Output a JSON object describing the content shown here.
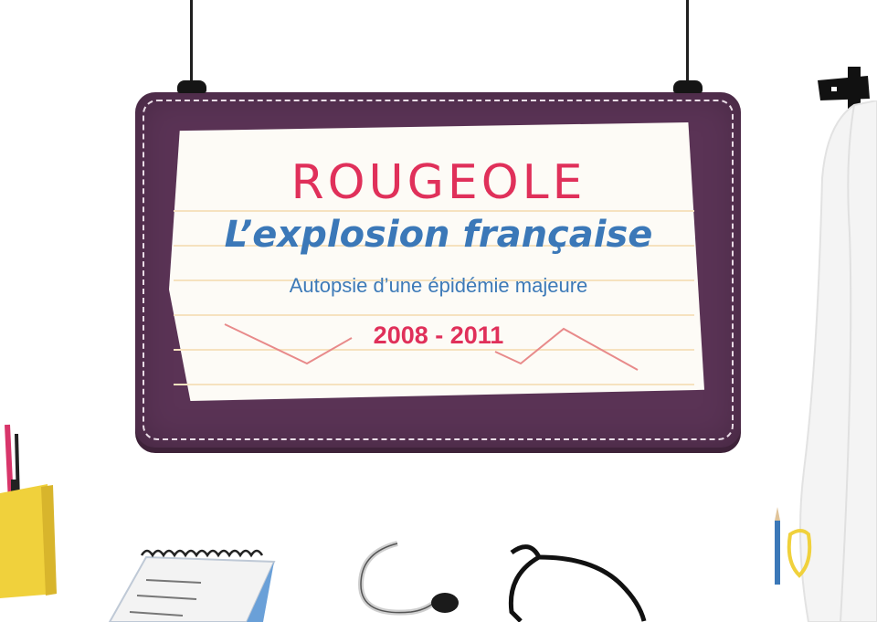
{
  "board": {
    "title": "ROUGEOLE",
    "headline": "L’explosion française",
    "subtitle": "Autopsie d’une épidémie majeure",
    "years": "2008 - 2011"
  },
  "colors": {
    "board": "#5a3355",
    "title": "#e0305a",
    "headline": "#3b78b8",
    "paper": "#fdfbf6"
  },
  "icons": [
    "pencil-cup-icon",
    "notepad-icon",
    "stethoscope-icon",
    "lab-coat-icon",
    "coat-hook-icon",
    "pencil-icon"
  ]
}
